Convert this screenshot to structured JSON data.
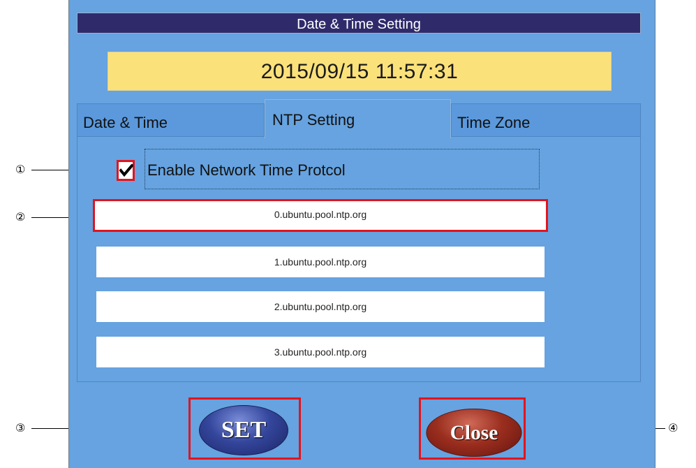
{
  "window": {
    "title": "Date & Time Setting",
    "current_datetime": "2015/09/15 11:57:31"
  },
  "tabs": [
    {
      "label": "Date & Time",
      "active": false
    },
    {
      "label": "NTP Setting",
      "active": true
    },
    {
      "label": "Time Zone",
      "active": false
    }
  ],
  "ntp": {
    "enable_label": "Enable Network Time Protcol",
    "enabled": true,
    "servers": [
      "0.ubuntu.pool.ntp.org",
      "1.ubuntu.pool.ntp.org",
      "2.ubuntu.pool.ntp.org",
      "3.ubuntu.pool.ntp.org"
    ]
  },
  "buttons": {
    "set_label": "SET",
    "close_label": "Close"
  },
  "callouts": [
    "①",
    "②",
    "③",
    "④"
  ],
  "colors": {
    "window_bg": "#66a3e0",
    "titlebar_bg": "#2f2b6b",
    "clock_bg": "#fbe17a",
    "highlight": "#e2141d",
    "set_button": "#34469c",
    "close_button": "#9a2e1e"
  }
}
